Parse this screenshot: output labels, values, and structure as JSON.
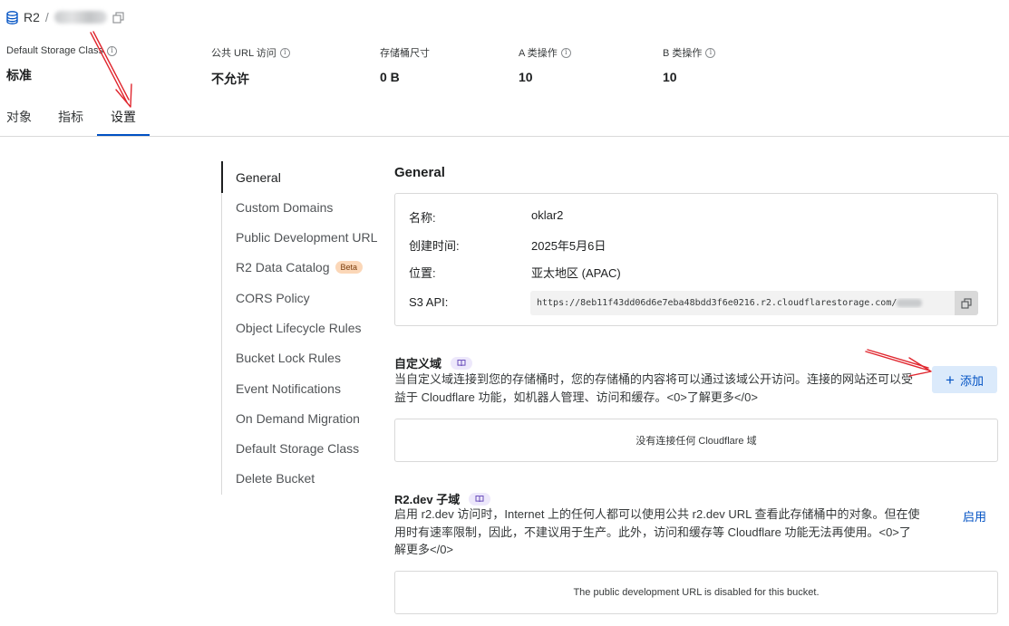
{
  "header": {
    "bucket_root": "R2",
    "separator": "/"
  },
  "stats": [
    {
      "label": "Default Storage Class",
      "value": "标准"
    },
    {
      "label": "公共 URL 访问",
      "value": "不允许"
    },
    {
      "label": "存储桶尺寸",
      "value": "0 B"
    },
    {
      "label": "A 类操作",
      "value": "10"
    },
    {
      "label": "B 类操作",
      "value": "10"
    }
  ],
  "tabs": [
    "对象",
    "指标",
    "设置"
  ],
  "nav": {
    "items": [
      "General",
      "Custom Domains",
      "Public Development URL",
      "R2 Data Catalog",
      "CORS Policy",
      "Object Lifecycle Rules",
      "Bucket Lock Rules",
      "Event Notifications",
      "On Demand Migration",
      "Default Storage Class",
      "Delete Bucket"
    ],
    "beta_badge": "Beta"
  },
  "general": {
    "title": "General",
    "name_label": "名称:",
    "name_value": "oklar2",
    "created_label": "创建时间:",
    "created_value": "2025年5月6日",
    "location_label": "位置:",
    "location_value": "亚太地区 (APAC)",
    "s3_label": "S3 API:",
    "s3_value": "https://8eb11f43dd06d6e7eba48bdd3f6e0216.r2.cloudflarestorage.com/"
  },
  "custom_domain": {
    "title": "自定义域",
    "description": "当自定义域连接到您的存储桶时，您的存储桶的内容将可以通过该域公开访问。连接的网站还可以受益于 Cloudflare 功能，如机器人管理、访问和缓存。<0>了解更多</0>",
    "add_label": "添加",
    "empty_text": "没有连接任何 Cloudflare 域"
  },
  "r2dev": {
    "title": "R2.dev 子域",
    "description": "启用 r2.dev 访问时，Internet 上的任何人都可以使用公共 r2.dev URL 查看此存储桶中的对象。但在使用时有速率限制，因此，不建议用于生产。此外，访问和缓存等 Cloudflare 功能无法再使用。<0>了解更多</0>",
    "enable_label": "启用",
    "disabled_text": "The public development URL is disabled for this bucket."
  },
  "colors": {
    "accent": "#0051c3",
    "annotation_arrow": "#e0262e"
  }
}
